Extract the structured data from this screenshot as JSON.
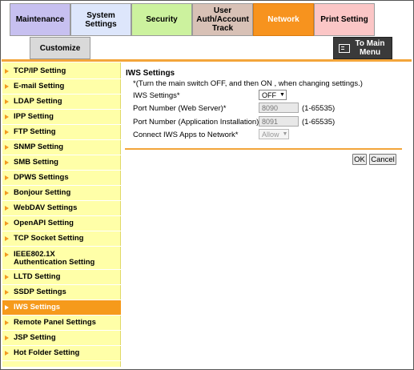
{
  "tabs": {
    "maintenance": "Maintenance",
    "system_settings": "System Settings",
    "security": "Security",
    "user_auth": "User Auth/Account Track",
    "network": "Network",
    "print_setting": "Print Setting",
    "customize": "Customize"
  },
  "to_main_menu": "To Main Menu",
  "sidebar": {
    "items": [
      {
        "label": "TCP/IP Setting"
      },
      {
        "label": "E-mail Setting"
      },
      {
        "label": "LDAP Setting"
      },
      {
        "label": "IPP Setting"
      },
      {
        "label": "FTP Setting"
      },
      {
        "label": "SNMP Setting"
      },
      {
        "label": "SMB Setting"
      },
      {
        "label": "DPWS Settings"
      },
      {
        "label": "Bonjour Setting"
      },
      {
        "label": "WebDAV Settings"
      },
      {
        "label": "OpenAPI Setting"
      },
      {
        "label": "TCP Socket Setting"
      },
      {
        "label": "IEEE802.1X Authentication Setting"
      },
      {
        "label": "LLTD Setting"
      },
      {
        "label": "SSDP Settings"
      },
      {
        "label": "IWS Settings"
      },
      {
        "label": "Remote Panel Settings"
      },
      {
        "label": "JSP Setting"
      },
      {
        "label": "Hot Folder Setting"
      }
    ],
    "active": "IWS Settings"
  },
  "content": {
    "title": "IWS Settings",
    "note": "*(Turn the main switch OFF, and then ON , when changing settings.)",
    "iws_settings_label": "IWS Settings*",
    "iws_settings_value": "OFF",
    "port_web_label": "Port Number (Web Server)*",
    "port_web_value": "8090",
    "port_web_range": "(1-65535)",
    "port_app_label": "Port Number (Application Installation)*",
    "port_app_value": "8091",
    "port_app_range": "(1-65535)",
    "connect_label": "Connect IWS Apps to Network*",
    "connect_value": "Allow",
    "ok_label": "OK",
    "cancel_label": "Cancel"
  },
  "colors": {
    "maintenance": "#c7c0f0",
    "system_settings": "#dde6fb",
    "security": "#ccf29e",
    "user_auth": "#d8c1b6",
    "network": "#f7931e",
    "print_setting": "#fbc6c6",
    "customize": "#d9d9d9",
    "accent": "#f69a1b",
    "sidebar_bg": "#ffffa8"
  }
}
